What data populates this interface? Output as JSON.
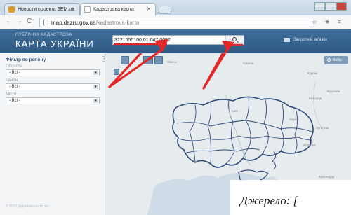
{
  "browser": {
    "tabs": [
      {
        "label": "Новости проекта ЗЕМ.ua",
        "active": false
      },
      {
        "label": "Кадастрова карта",
        "active": true
      }
    ],
    "nav": {
      "back": "←",
      "forward": "→",
      "reload": "C"
    },
    "url_host": "map.dazru.gov.ua",
    "url_path": "/kadastrova-karta",
    "toolbar_icons": "☆ ★ ≡"
  },
  "header": {
    "brand_small": "ПУБЛІЧНА КАДАСТРОВА",
    "brand_big": "КАРТА УКРАЇНИ",
    "search_value": "3221655100:01:047:0052",
    "feedback_label": "Зворотній зв'язок"
  },
  "sidebar": {
    "filter_title": "Фільтр по регіону",
    "fields": [
      {
        "label": "Область",
        "value": "- Всі -"
      },
      {
        "label": "Район",
        "value": "- Всі -"
      },
      {
        "label": "Місто",
        "value": "- Всі -"
      }
    ],
    "collapse_glyph": "«",
    "copyright": "© 2012 Держземагентство"
  },
  "map": {
    "basemap_label": "Вибір",
    "cities": [
      "Мінськ",
      "Гомель",
      "Київ",
      "Курськ",
      "Воронеж",
      "Білгород",
      "Харків",
      "Луганськ",
      "Донецьк",
      "Краснодар"
    ]
  },
  "annotation_colors": {
    "arrow": "#e32626",
    "underline": "#e32626"
  },
  "caption": "Джерело: ["
}
